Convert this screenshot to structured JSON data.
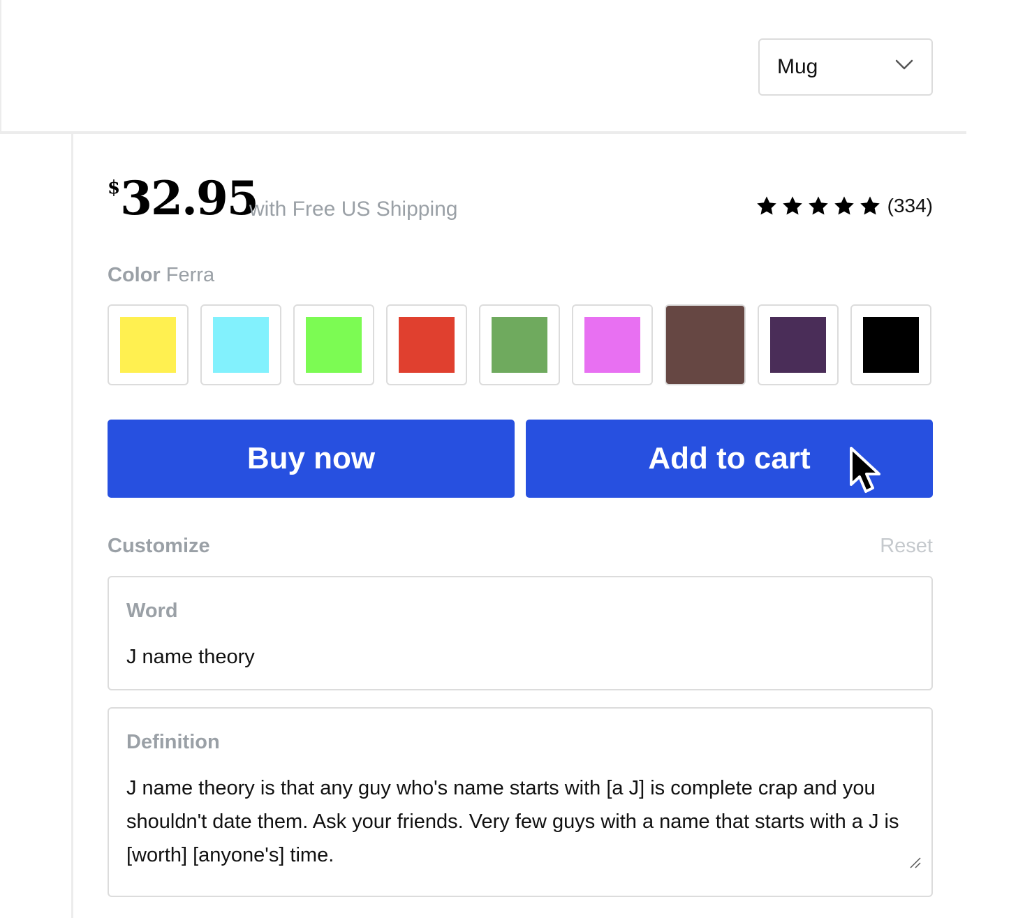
{
  "product_selector": {
    "selected": "Mug"
  },
  "price": {
    "currency": "$",
    "amount": "32.95",
    "shipping_note": "with Free US Shipping"
  },
  "rating": {
    "stars": 5,
    "count_label": "(334)"
  },
  "color": {
    "label": "Color",
    "selected_name": "Ferra",
    "swatches": [
      {
        "hex": "#fff050"
      },
      {
        "hex": "#82f1fd"
      },
      {
        "hex": "#7cfb53"
      },
      {
        "hex": "#e0402f"
      },
      {
        "hex": "#6faa5e"
      },
      {
        "hex": "#e870f2"
      },
      {
        "hex": "#664743",
        "selected": true
      },
      {
        "hex": "#4a2d58"
      },
      {
        "hex": "#000000"
      }
    ]
  },
  "actions": {
    "buy_now": "Buy now",
    "add_to_cart": "Add to cart"
  },
  "customize": {
    "label": "Customize",
    "reset": "Reset",
    "word_label": "Word",
    "word_value": "J name theory",
    "definition_label": "Definition",
    "definition_value": "J name theory is that any guy who's name starts with [a J] is complete crap and you shouldn't date them. Ask your friends. Very few guys with a name that starts with a J is [worth] [anyone's] time."
  },
  "theme": {
    "accent": "#2750e0",
    "muted_text": "#9aa0a6",
    "border": "#dcdcdc"
  }
}
